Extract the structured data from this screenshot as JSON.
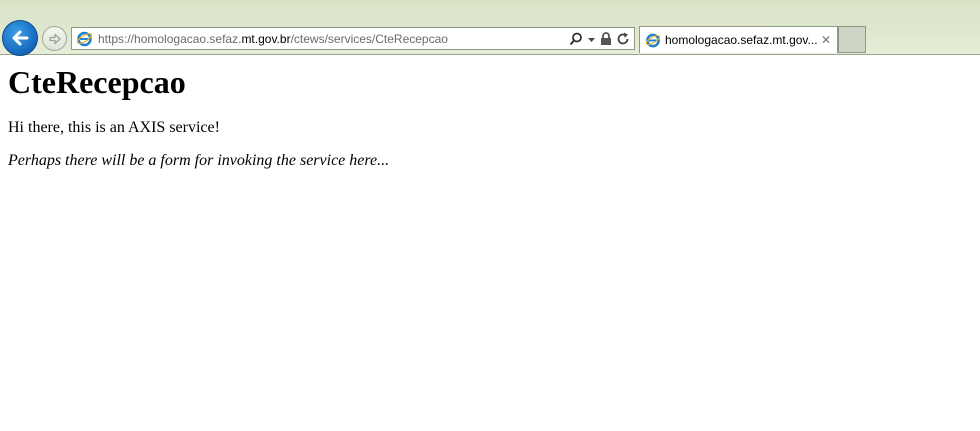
{
  "browser": {
    "address_bar": {
      "scheme": "https://",
      "host_sub": "homologacao.sefaz.",
      "host_domain": "mt.gov.br",
      "path": "/ctews/services/CteRecepcao"
    },
    "tabs": [
      {
        "title": "homologacao.sefaz.mt.gov...",
        "active": true
      }
    ],
    "icons": {
      "back": "back-arrow-icon",
      "forward": "forward-arrow-icon",
      "site": "ie-logo-icon",
      "search": "search-icon",
      "dropdown": "chevron-down-icon",
      "lock": "lock-icon",
      "refresh": "refresh-icon",
      "close": "close-icon"
    },
    "colors": {
      "back_button": "#1a6fc4",
      "chrome_bg": "#dfe8cf"
    }
  },
  "page": {
    "heading": "CteRecepcao",
    "intro": "Hi there, this is an AXIS service!",
    "note": "Perhaps there will be a form for invoking the service here..."
  }
}
